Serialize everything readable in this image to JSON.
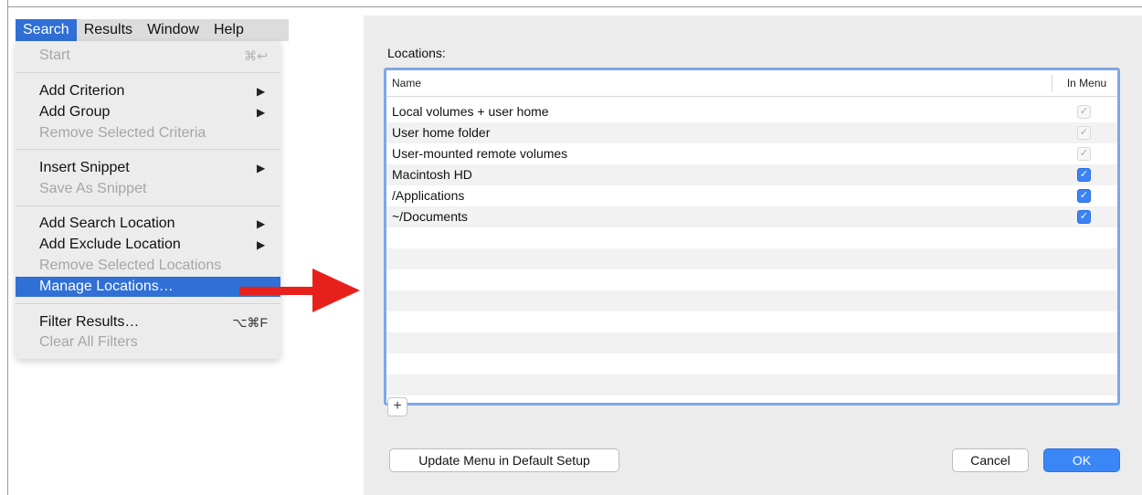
{
  "menubar": {
    "titles": [
      "Search",
      "Results",
      "Window",
      "Help"
    ]
  },
  "menu": {
    "start": {
      "label": "Start",
      "shortcut": "⌘↩"
    },
    "add_criterion": {
      "label": "Add Criterion"
    },
    "add_group": {
      "label": "Add Group"
    },
    "remove_selected_criteria": {
      "label": "Remove Selected Criteria"
    },
    "insert_snippet": {
      "label": "Insert Snippet"
    },
    "save_as_snippet": {
      "label": "Save As Snippet"
    },
    "add_search_location": {
      "label": "Add Search Location"
    },
    "add_exclude_location": {
      "label": "Add Exclude Location"
    },
    "remove_selected_locations": {
      "label": "Remove Selected Locations"
    },
    "manage_locations": {
      "label": "Manage Locations…"
    },
    "filter_results": {
      "label": "Filter Results…",
      "shortcut": "⌥⌘F"
    },
    "clear_all_filters": {
      "label": "Clear All Filters"
    },
    "submenu_arrow": "▶"
  },
  "dialog": {
    "locations_label": "Locations:",
    "columns": {
      "name": "Name",
      "in_menu": "In Menu"
    },
    "rows": [
      {
        "name": "Local volumes + user home",
        "in_menu": true,
        "enabled": false,
        "mark": "✓"
      },
      {
        "name": "User home folder",
        "in_menu": true,
        "enabled": false,
        "mark": "✓"
      },
      {
        "name": "User-mounted remote volumes",
        "in_menu": true,
        "enabled": false,
        "mark": "✓"
      },
      {
        "name": "Macintosh HD",
        "in_menu": true,
        "enabled": true,
        "mark": "✓"
      },
      {
        "name": "/Applications",
        "in_menu": true,
        "enabled": true,
        "mark": "✓"
      },
      {
        "name": "~/Documents",
        "in_menu": true,
        "enabled": true,
        "mark": "✓"
      }
    ],
    "add_button": "+",
    "update_menu_button": "Update Menu in Default Setup",
    "cancel_button": "Cancel",
    "ok_button": "OK"
  },
  "colors": {
    "accent": "#2f6fd6",
    "arrow": "#e8201c",
    "table_border": "#7ea8e6",
    "ok_button": "#3b86f7"
  },
  "icons": {
    "arrow": "red-arrow-icon",
    "submenu": "chevron-right-icon",
    "checkbox": "checkmark-icon"
  }
}
